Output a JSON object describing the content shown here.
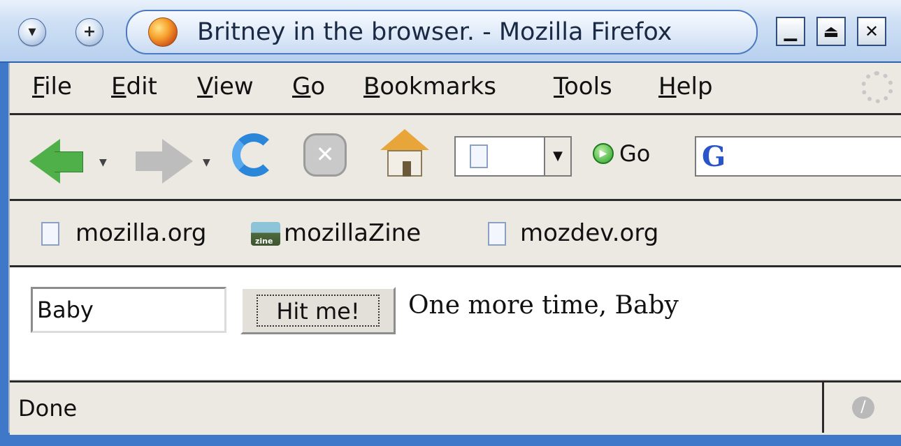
{
  "window": {
    "title": "Britney in the browser. - Mozilla Firefox",
    "controls": {
      "minimize": "▁",
      "maximize": "⏏",
      "close": "✕"
    },
    "menu_button": "▾",
    "add_button": "+"
  },
  "menubar": {
    "items": [
      {
        "label_mnemonic": "F",
        "label_rest": "ile"
      },
      {
        "label_mnemonic": "E",
        "label_rest": "dit"
      },
      {
        "label_mnemonic": "V",
        "label_rest": "iew"
      },
      {
        "label_mnemonic": "G",
        "label_rest": "o"
      },
      {
        "label_mnemonic": "B",
        "label_rest": "ookmarks"
      },
      {
        "label_mnemonic": "T",
        "label_rest": "ools"
      },
      {
        "label_mnemonic": "H",
        "label_rest": "elp"
      }
    ]
  },
  "navbar": {
    "go_label": "Go",
    "url_value": "",
    "search_engine_letter": "G",
    "dropdown_glyph": "▼",
    "stop_glyph": "✕",
    "go_glyph": "▶"
  },
  "bookmarks": {
    "items": [
      {
        "label": "mozilla.org",
        "icon": "page-icon"
      },
      {
        "label": "mozillaZine",
        "icon": "zine-icon",
        "icon_text": "zine"
      },
      {
        "label": "mozdev.org",
        "icon": "page-icon"
      }
    ]
  },
  "page": {
    "input_value": "Baby",
    "button_label": "Hit me!",
    "result_text": "One more time, Baby"
  },
  "statusbar": {
    "text": "Done",
    "security_glyph": "/"
  },
  "colors": {
    "frame_blue": "#3f78c8",
    "chrome_bg": "#ece9e3",
    "back_green": "#4fb04a",
    "reload_blue": "#2a86d8",
    "home_roof": "#e8a53a"
  }
}
